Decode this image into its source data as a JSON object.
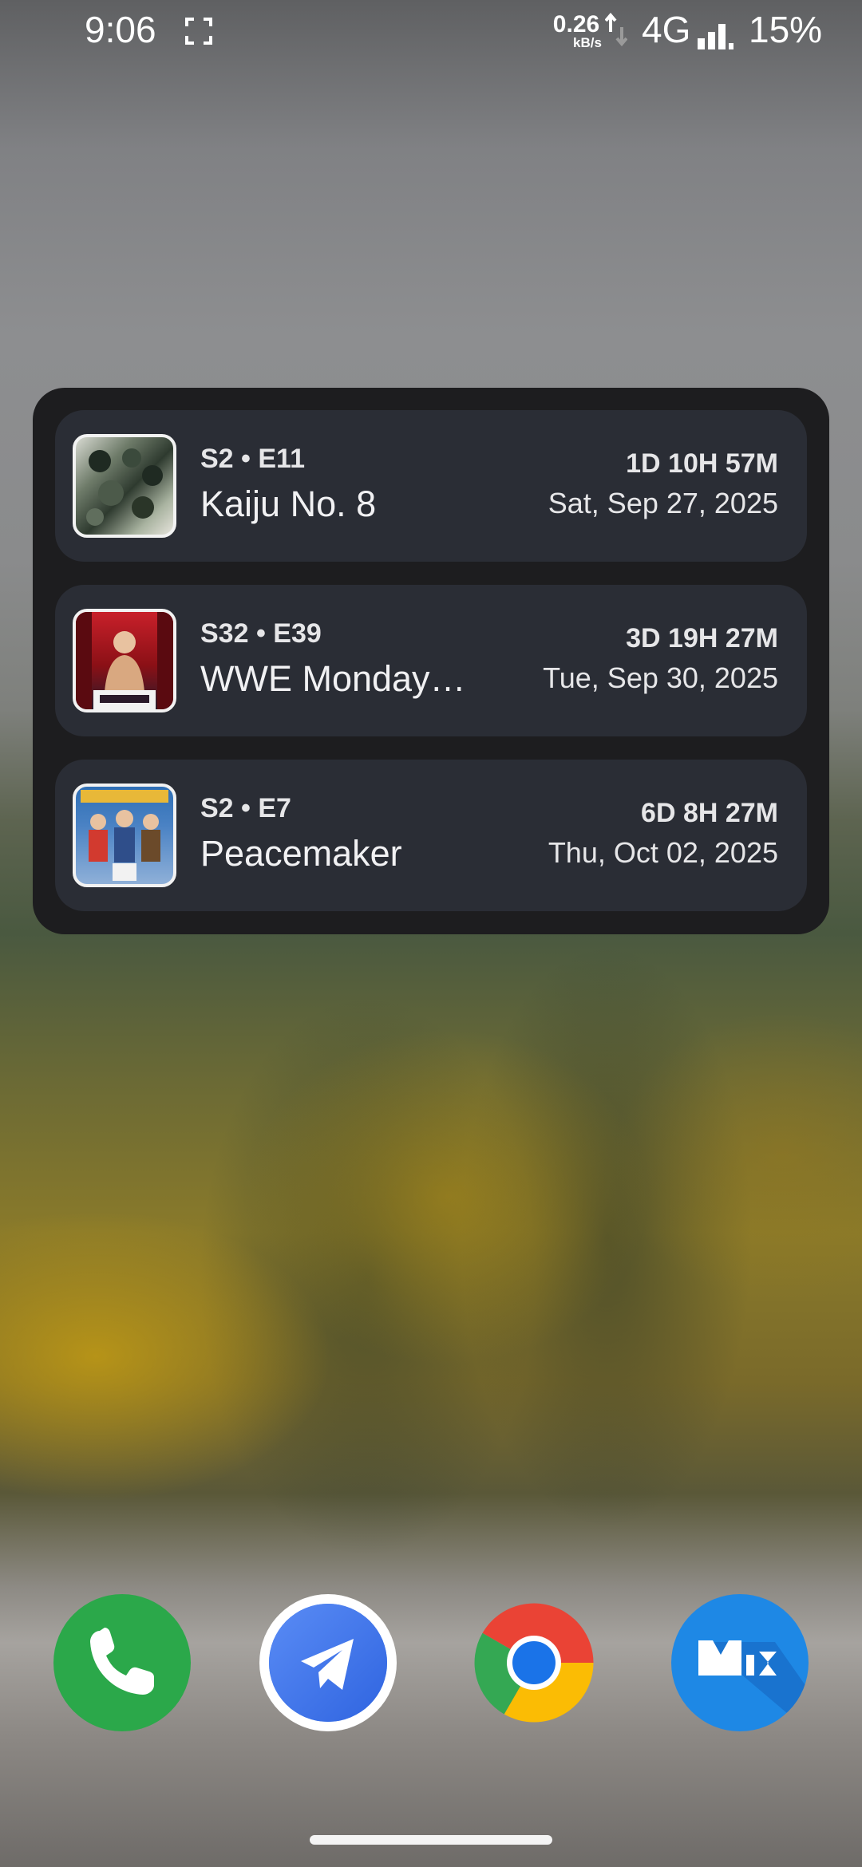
{
  "status_bar": {
    "time": "9:06",
    "net_speed": "0.26",
    "net_speed_unit": "kB/s",
    "network": "4G",
    "battery": "15%",
    "icons": [
      "screenshot-icon",
      "upload-download-arrows-icon",
      "signal-icon"
    ]
  },
  "widget": {
    "items": [
      {
        "episode": "S2 • E11",
        "title": "Kaiju No. 8",
        "countdown": "1D 10H 57M",
        "date": "Sat, Sep 27, 2025",
        "poster_colors": [
          "#2e3a2f",
          "#8a9a86",
          "#d8dad2"
        ]
      },
      {
        "episode": "S32 • E39",
        "title": "WWE Monday…",
        "countdown": "3D 19H 27M",
        "date": "Tue, Sep 30, 2025",
        "poster_colors": [
          "#8b1016",
          "#c8202a",
          "#2a1a2a"
        ]
      },
      {
        "episode": "S2 • E7",
        "title": "Peacemaker",
        "countdown": "6D 8H 27M",
        "date": "Thu, Oct 02, 2025",
        "poster_colors": [
          "#2f6fb5",
          "#d23a2f",
          "#e8b838"
        ]
      }
    ],
    "background": "#1d1d1f",
    "card_color": "#2a2d35"
  },
  "dock": {
    "apps": [
      {
        "name": "phone-icon",
        "color": "#2ba84a"
      },
      {
        "name": "telegram-icon",
        "color": "#3a7af0"
      },
      {
        "name": "chrome-icon",
        "color": "#1a73e8"
      },
      {
        "name": "mix-icon",
        "color": "#1e88e5"
      }
    ]
  }
}
